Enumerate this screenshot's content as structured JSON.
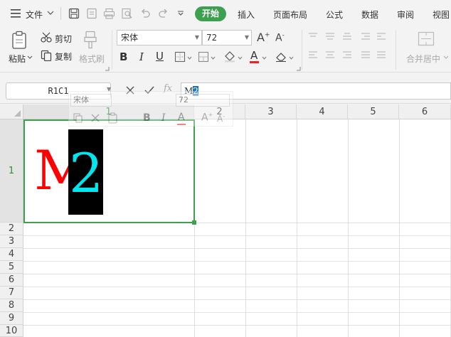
{
  "menu": {
    "file": "文件",
    "tabs": [
      "开始",
      "插入",
      "页面布局",
      "公式",
      "数据",
      "审阅",
      "视图"
    ]
  },
  "ribbon": {
    "paste": "粘贴",
    "cut": "剪切",
    "copy": "复制",
    "format_painter": "格式刷",
    "font_name": "宋体",
    "font_size": "72",
    "bold": "B",
    "italic": "I",
    "underline": "U",
    "merge_center": "合并居中"
  },
  "formula_bar": {
    "name_box": "R1C1",
    "fx": "fx",
    "content_normal": "M",
    "content_selected": "2"
  },
  "mini_toolbar": {
    "font_name": "宋体",
    "font_size": "72"
  },
  "grid": {
    "columns": [
      "1",
      "2",
      "3",
      "4",
      "5",
      "6"
    ],
    "rows": [
      "1",
      "2",
      "3",
      "4",
      "5",
      "6",
      "7",
      "8",
      "9",
      "10"
    ],
    "cell_r1c1": {
      "char1": "M",
      "char2": "2",
      "char1_color": "#ff0000",
      "char2_color": "#00e5ee",
      "char2_bg": "#000000"
    }
  },
  "colors": {
    "accent": "#3da04f",
    "selection": "#1a73c7"
  }
}
